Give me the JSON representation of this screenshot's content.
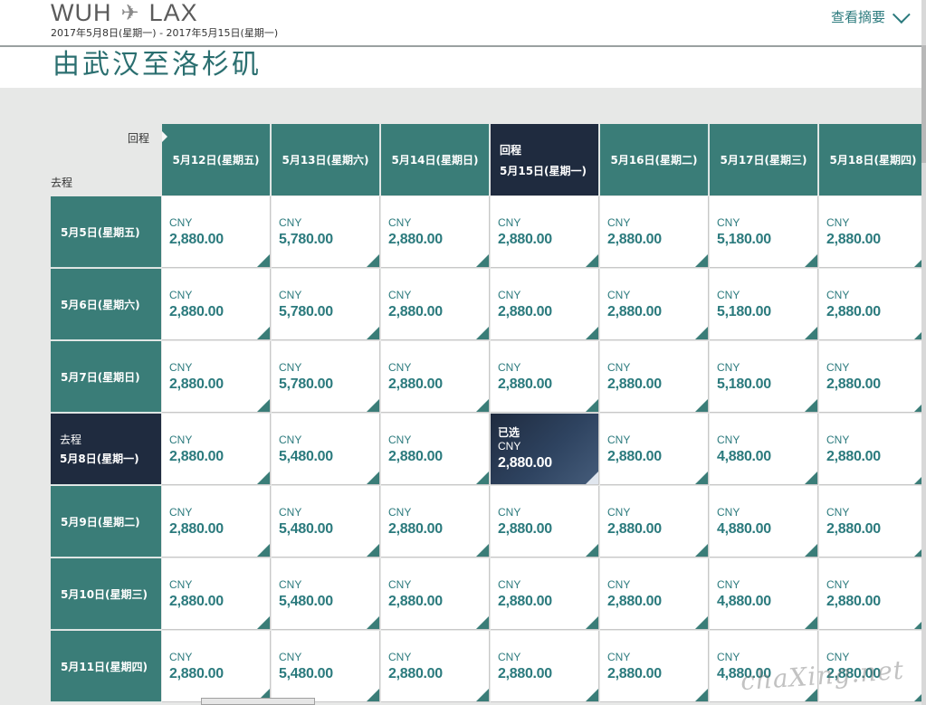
{
  "header": {
    "origin": "WUH",
    "destination": "LAX",
    "date_range": "2017年5月8日(星期一) - 2017年5月15日(星期一)",
    "summary_label": "查看摘要",
    "band_title": "由武汉至洛杉矶"
  },
  "grid": {
    "return_axis_label": "回程",
    "depart_axis_label": "去程",
    "selected_label_return": "回程",
    "selected_label_depart": "去程",
    "selected_badge": "已选",
    "currency": "CNY",
    "columns": [
      "5月12日(星期五)",
      "5月13日(星期六)",
      "5月14日(星期日)",
      "5月15日(星期一)",
      "5月16日(星期二)",
      "5月17日(星期三)",
      "5月18日(星期四)"
    ],
    "rows": [
      {
        "label": "5月5日(星期五)",
        "prices": [
          "2,880.00",
          "5,780.00",
          "2,880.00",
          "2,880.00",
          "2,880.00",
          "5,180.00",
          "2,880.00"
        ]
      },
      {
        "label": "5月6日(星期六)",
        "prices": [
          "2,880.00",
          "5,780.00",
          "2,880.00",
          "2,880.00",
          "2,880.00",
          "5,180.00",
          "2,880.00"
        ]
      },
      {
        "label": "5月7日(星期日)",
        "prices": [
          "2,880.00",
          "5,780.00",
          "2,880.00",
          "2,880.00",
          "2,880.00",
          "5,180.00",
          "2,880.00"
        ]
      },
      {
        "label": "5月8日(星期一)",
        "prices": [
          "2,880.00",
          "5,480.00",
          "2,880.00",
          "2,880.00",
          "2,880.00",
          "4,880.00",
          "2,880.00"
        ]
      },
      {
        "label": "5月9日(星期二)",
        "prices": [
          "2,880.00",
          "5,480.00",
          "2,880.00",
          "2,880.00",
          "2,880.00",
          "4,880.00",
          "2,880.00"
        ]
      },
      {
        "label": "5月10日(星期三)",
        "prices": [
          "2,880.00",
          "5,480.00",
          "2,880.00",
          "2,880.00",
          "2,880.00",
          "4,880.00",
          "2,880.00"
        ]
      },
      {
        "label": "5月11日(星期四)",
        "prices": [
          "2,880.00",
          "5,480.00",
          "2,880.00",
          "2,880.00",
          "2,880.00",
          "4,880.00",
          "2,880.00"
        ]
      }
    ],
    "selected_row": 3,
    "selected_col": 3
  },
  "watermark": "chaXing.net",
  "colors": {
    "teal": "#3a7d78",
    "navy": "#1f2b3f",
    "price_text": "#2b7a7d"
  }
}
